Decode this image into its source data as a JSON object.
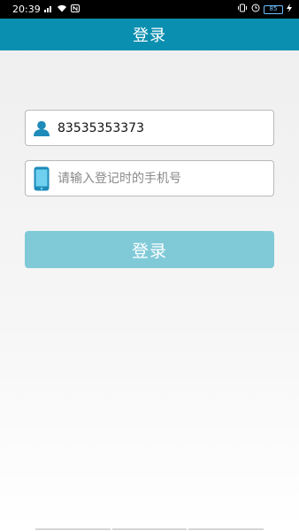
{
  "status_bar": {
    "time": "20:39",
    "battery": "85",
    "left_icons": [
      "signal-icon",
      "wifi-icon",
      "nfc-icon"
    ],
    "right_icons": [
      "vibrate-icon",
      "alarm-icon",
      "battery-icon",
      "charging-icon"
    ]
  },
  "app_bar": {
    "title": "登录",
    "color": "#0b8fb0"
  },
  "form": {
    "username": {
      "icon": "user-icon",
      "value": "83535353373",
      "placeholder": ""
    },
    "phone": {
      "icon": "mobile-phone-icon",
      "value": "",
      "placeholder": "请输入登记时的手机号"
    },
    "submit_label": "登录",
    "submit_color": "#80cad8"
  }
}
